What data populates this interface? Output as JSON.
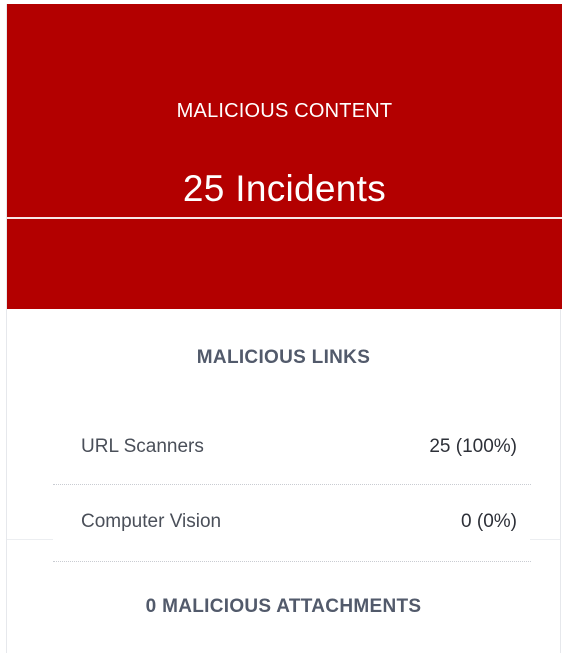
{
  "hero": {
    "label": "MALICIOUS CONTENT",
    "value": "25 Incidents",
    "background": "#b30000"
  },
  "links": {
    "title": "MALICIOUS LINKS",
    "rows": [
      {
        "label": "URL Scanners",
        "value": "25 (100%)"
      },
      {
        "label": "Computer Vision",
        "value": "0 (0%)"
      }
    ]
  },
  "attachments": {
    "title": "0 MALICIOUS ATTACHMENTS"
  }
}
